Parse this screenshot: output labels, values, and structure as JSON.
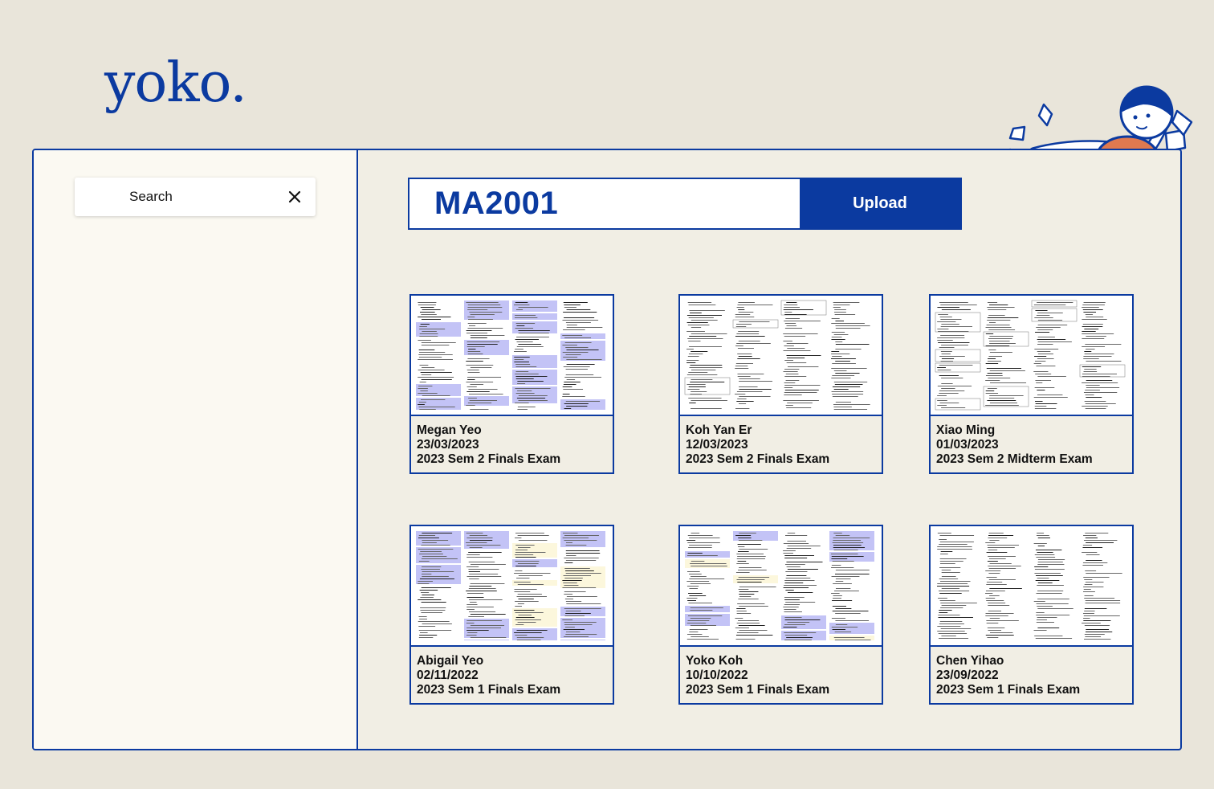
{
  "brand": {
    "logo_text": "yoko."
  },
  "search": {
    "placeholder": "Search",
    "value": ""
  },
  "header": {
    "course_code": "MA2001",
    "upload_label": "Upload"
  },
  "colors": {
    "accent": "#0b3aa0",
    "page_bg": "#e9e5da",
    "sidebar_bg": "#fbf9f2",
    "highlight": "#b9b9f4"
  },
  "cards": [
    {
      "name": "Megan Yeo",
      "date": "23/03/2023",
      "exam": "2023 Sem 2 Finals Exam"
    },
    {
      "name": "Koh Yan Er",
      "date": "12/03/2023",
      "exam": "2023 Sem 2 Finals Exam"
    },
    {
      "name": "Xiao Ming",
      "date": "01/03/2023",
      "exam": "2023 Sem 2 Midterm Exam"
    },
    {
      "name": "Abigail Yeo",
      "date": "02/11/2022",
      "exam": "2023 Sem 1 Finals Exam"
    },
    {
      "name": "Yoko Koh",
      "date": "10/10/2022",
      "exam": "2023 Sem 1 Finals Exam"
    },
    {
      "name": "Chen Yihao",
      "date": "23/09/2022",
      "exam": "2023 Sem 1 Finals Exam"
    }
  ],
  "icons": {
    "clear": "close-icon",
    "mascot": "mascot-illustration"
  }
}
